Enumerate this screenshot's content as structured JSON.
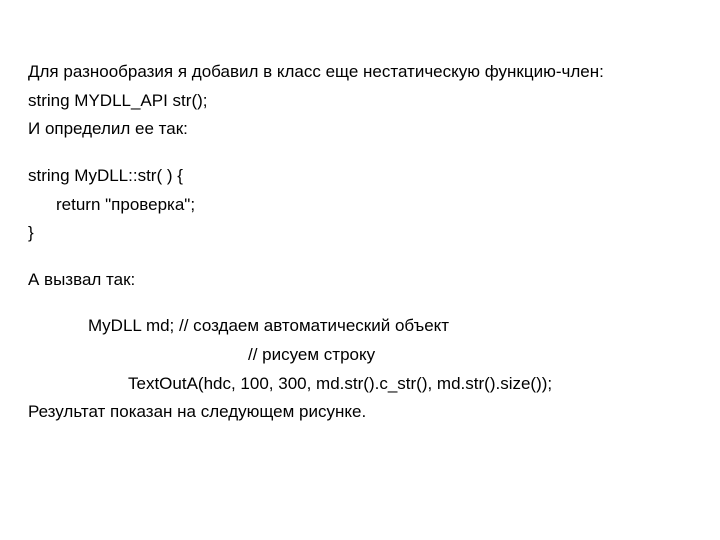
{
  "doc": {
    "p1": "Для разнообразия я добавил  в класс  еще нестатическую функцию-член:",
    "p2": "string MYDLL_API str();",
    "p3": "И определил ее так:",
    "code1_l1": "string    MyDLL::str( ) {",
    "code1_l2": "return   \"проверка\";",
    "code1_l3": "}",
    "p4": "А вызвал так:",
    "code2_l1": "MyDLL md;  //  создаем автоматический объект",
    "code2_l2": "// рисуем строку",
    "code2_l3": "TextOutA(hdc, 100, 300, md.str().c_str(),  md.str().size());",
    "p5": "Результат показан на следующем рисунке."
  }
}
